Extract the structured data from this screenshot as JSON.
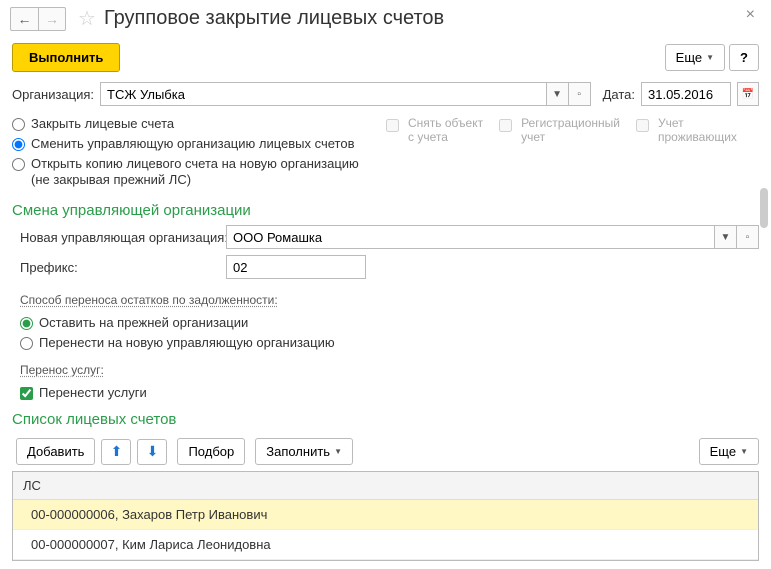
{
  "header": {
    "title": "Групповое закрытие лицевых счетов"
  },
  "toolbar": {
    "execute_label": "Выполнить",
    "more_label": "Еще",
    "help_label": "?"
  },
  "org": {
    "label": "Организация:",
    "value": "ТСЖ Улыбка",
    "date_label": "Дата:",
    "date_value": "31.05.2016"
  },
  "action_radios": {
    "close": "Закрыть лицевые счета",
    "change": "Сменить управляющую организацию лицевых счетов",
    "copy_line1": "Открыть копию лицевого счета на новую организацию",
    "copy_line2": "(не закрывая прежний ЛС)"
  },
  "right_checks": {
    "remove_line1": "Снять объект",
    "remove_line2": "с учета",
    "reg_line1": "Регистрационный",
    "reg_line2": "учет",
    "living_line1": "Учет",
    "living_line2": "проживающих"
  },
  "section_change": {
    "title": "Смена управляющей организации",
    "new_org_label": "Новая управляющая организация:",
    "new_org_value": "ООО Ромашка",
    "prefix_label": "Префикс:",
    "prefix_value": "02",
    "balance_method_label": "Способ переноса остатков по задолженности:",
    "balance_keep": "Оставить на прежней организации",
    "balance_move": "Перенести на новую управляющую организацию",
    "svc_label": "Перенос услуг:",
    "svc_move": "Перенести услуги"
  },
  "section_list": {
    "title": "Список лицевых счетов",
    "add_label": "Добавить",
    "pick_label": "Подбор",
    "fill_label": "Заполнить",
    "more_label": "Еще",
    "col_header": "ЛС",
    "rows": [
      "00-000000006, Захаров Петр Иванович",
      "00-000000007, Ким Лариса Леонидовна"
    ]
  }
}
